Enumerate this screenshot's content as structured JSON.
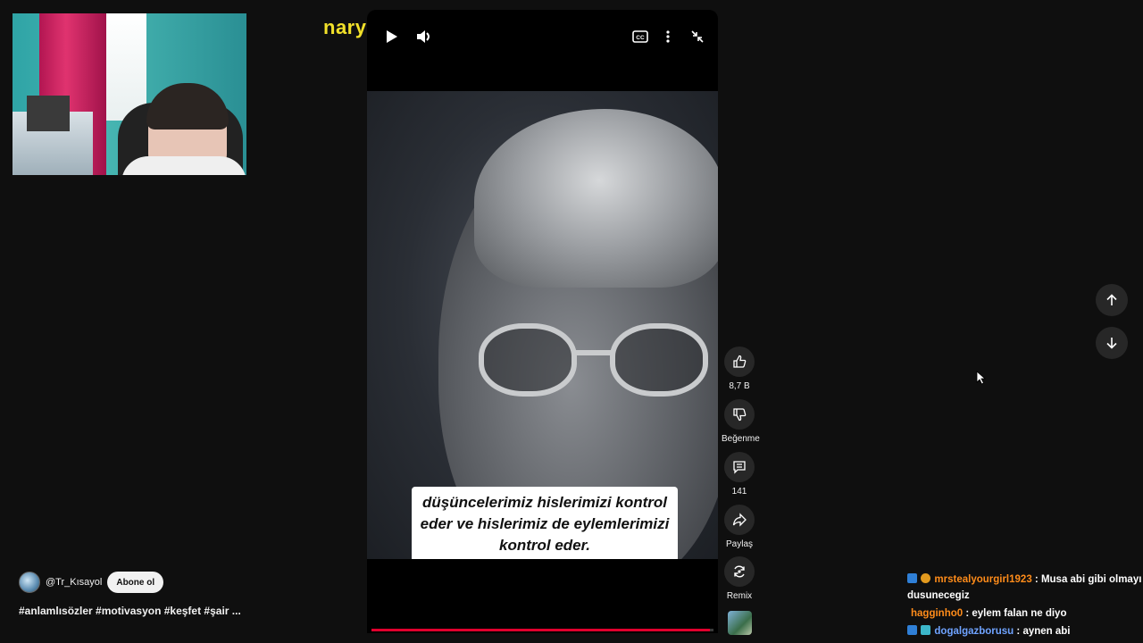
{
  "stream": {
    "title_fragment": "naryus"
  },
  "player": {
    "subtitle": "düşüncelerimiz hislerimizi kontrol eder ve hislerimiz de eylemlerimizi kontrol eder.",
    "progress_percent": 99,
    "progress_color": "#e1002d",
    "controls": [
      "play-icon",
      "volume-icon",
      "captions-icon",
      "more-icon",
      "minimize-icon"
    ]
  },
  "actions": {
    "like_count": "8,7 B",
    "dislike_label": "Beğenme",
    "comment_count": "141",
    "share_label": "Paylaş",
    "remix_label": "Remix"
  },
  "channel": {
    "handle": "@Tr_Kısayol",
    "subscribe_label": "Abone ol",
    "description": "#anlamlısözler #motivasyon #keşfet #şair ..."
  },
  "chat": {
    "messages": [
      {
        "user": "mrstealyourgirl1923",
        "color": "#ff8c1a",
        "text": ": Musa abi gibi olmayı dusunecegiz"
      },
      {
        "user": "hagginho0",
        "color": "#ff8c1a",
        "text": ": eylem falan ne diyo"
      },
      {
        "user": "dogalgazborusu",
        "color": "#6fa3ff",
        "text": ": aynen abi"
      }
    ]
  }
}
